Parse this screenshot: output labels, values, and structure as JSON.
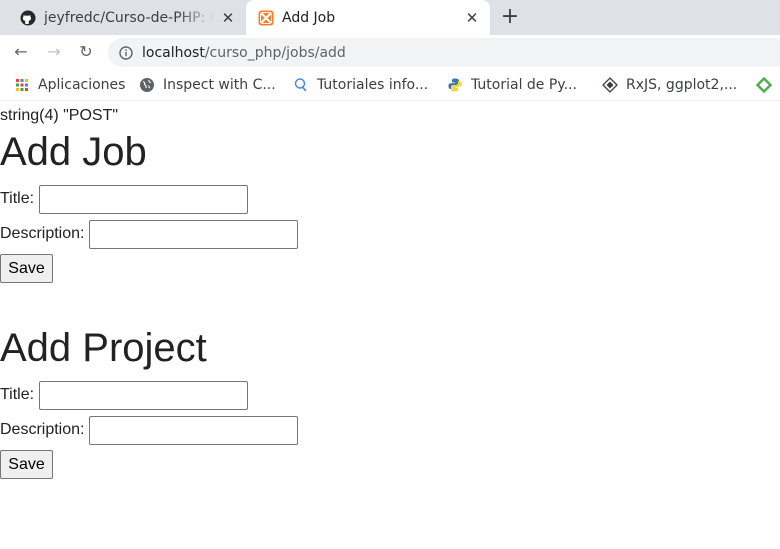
{
  "browser": {
    "tabs": [
      {
        "title": "jeyfredc/Curso-de-PHP: Curso de PHP",
        "active": false,
        "icon": "github-icon"
      },
      {
        "title": "Add Job",
        "active": true,
        "icon": "xampp-icon"
      }
    ],
    "close_glyph": "✕",
    "new_tab_glyph": "+",
    "nav": {
      "back": "←",
      "forward": "→",
      "reload": "↻"
    },
    "address": {
      "host": "localhost",
      "path": "/curso_php/jobs/add"
    },
    "bookmarks": [
      {
        "label": "Aplicaciones",
        "icon": "apps-grid-icon"
      },
      {
        "label": "Inspect with C...",
        "icon": "globe-icon"
      },
      {
        "label": "Tutoriales info...",
        "icon": "bulb-icon"
      },
      {
        "label": "Tutorial de Py...",
        "icon": "python-icon"
      },
      {
        "label": "RxJS, ggplot2,...",
        "icon": "diamond-icon"
      }
    ]
  },
  "page": {
    "debug_output": "string(4) \"POST\"",
    "job_form": {
      "heading": "Add Job",
      "title_label": "Title:",
      "title_value": "",
      "description_label": "Description:",
      "description_value": "",
      "save_label": "Save"
    },
    "project_form": {
      "heading": "Add Project",
      "title_label": "Title:",
      "title_value": "",
      "description_label": "Description:",
      "description_value": "",
      "save_label": "Save"
    }
  },
  "colors": {
    "tabstrip": "#dee1e6",
    "omnibox": "#f1f3f4",
    "xampp_orange": "#fb7a24",
    "python_blue": "#3776ab",
    "python_yellow": "#ffd43b"
  }
}
